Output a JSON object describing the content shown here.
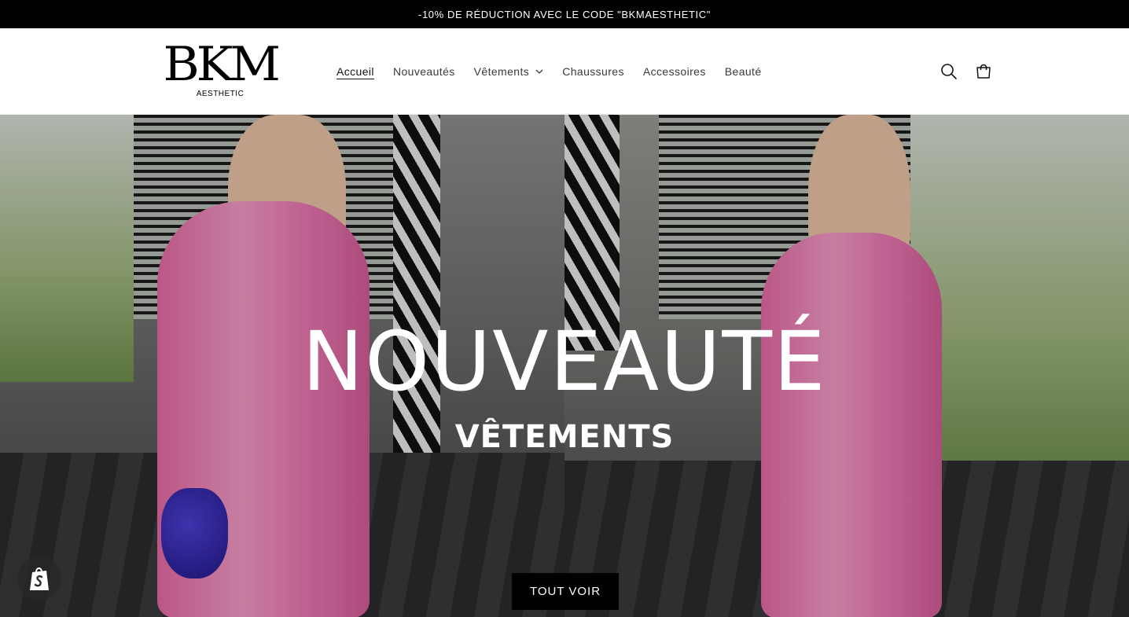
{
  "announcement": {
    "text": "-10% DE RÉDUCTION AVEC LE CODE \"BKMAESTHETIC\""
  },
  "header": {
    "logo_mark": "BKM",
    "logo_sub": "AESTHETIC",
    "nav": [
      {
        "label": "Accueil",
        "active": true
      },
      {
        "label": "Nouveautés"
      },
      {
        "label": "Vêtements",
        "has_dropdown": true
      },
      {
        "label": "Chaussures"
      },
      {
        "label": "Accessoires"
      },
      {
        "label": "Beauté"
      }
    ],
    "icons": {
      "search": "search-icon",
      "cart": "cart-icon",
      "dropdown": "chevron-down-icon"
    }
  },
  "hero": {
    "title": "NOUVEAUTÉ",
    "subtitle": "VÊTEMENTS",
    "cta_label": "TOUT VOIR"
  },
  "colors": {
    "announcement_bg": "#000000",
    "cta_bg": "#000000",
    "text": "#121212",
    "dress_pink": "#f39bc6",
    "bag_blue": "#3b2fc4"
  },
  "badge": {
    "icon": "shopify-bag-icon"
  }
}
